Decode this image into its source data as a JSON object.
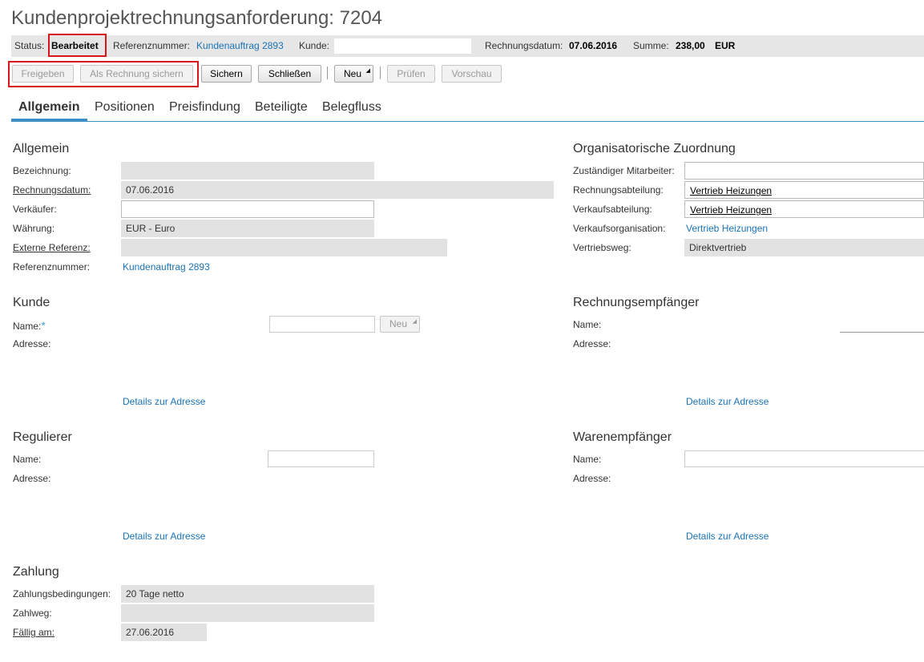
{
  "title": "Kundenprojektrechnungsanforderung: 7204",
  "status_bar": {
    "status_label": "Status:",
    "status_value": "Bearbeitet",
    "ref_label": "Referenznummer:",
    "ref_value": "Kundenauftrag 2893",
    "customer_label": "Kunde:",
    "customer_value": "",
    "date_label": "Rechnungsdatum:",
    "date_value": "07.06.2016",
    "sum_label": "Summe:",
    "sum_value": "238,00",
    "currency": "EUR"
  },
  "toolbar": {
    "release": "Freigeben",
    "save_as_invoice": "Als Rechnung sichern",
    "save": "Sichern",
    "close": "Schließen",
    "new": "Neu",
    "check": "Prüfen",
    "preview": "Vorschau"
  },
  "tabs": [
    "Allgemein",
    "Positionen",
    "Preisfindung",
    "Beteiligte",
    "Belegfluss"
  ],
  "general": {
    "heading": "Allgemein",
    "description_label": "Bezeichnung:",
    "description_value": "",
    "invoice_date_label": "Rechnungsdatum:",
    "invoice_date_value": "07.06.2016",
    "seller_label": "Verkäufer:",
    "seller_value": "",
    "currency_label": "Währung:",
    "currency_value": "EUR - Euro",
    "ext_ref_label": "Externe Referenz:",
    "ext_ref_value": "",
    "ref_label": "Referenznummer:",
    "ref_value": "Kundenauftrag 2893"
  },
  "org": {
    "heading": "Organisatorische Zuordnung",
    "employee_label": "Zuständiger Mitarbeiter:",
    "employee_value": "",
    "invoice_dept_label": "Rechnungsabteilung:",
    "invoice_dept_value": "Vertrieb Heizungen",
    "sales_dept_label": "Verkaufsabteilung:",
    "sales_dept_value": "Vertrieb Heizungen",
    "sales_org_label": "Verkaufsorganisation:",
    "sales_org_value": "Vertrieb Heizungen",
    "channel_label": "Vertriebsweg:",
    "channel_value": "Direktvertrieb"
  },
  "customer": {
    "heading": "Kunde",
    "name_label": "Name:",
    "name_value": "",
    "new_button": "Neu",
    "address_label": "Adresse:",
    "address_link": "Details zur Adresse"
  },
  "bill_to": {
    "heading": "Rechnungsempfänger",
    "name_label": "Name:",
    "address_label": "Adresse:",
    "address_link": "Details zur Adresse"
  },
  "payer": {
    "heading": "Regulierer",
    "name_label": "Name:",
    "address_label": "Adresse:",
    "address_link": "Details zur Adresse"
  },
  "ship_to": {
    "heading": "Warenempfänger",
    "name_label": "Name:",
    "address_label": "Adresse:",
    "address_link": "Details zur Adresse"
  },
  "payment": {
    "heading": "Zahlung",
    "terms_label": "Zahlungsbedingungen:",
    "terms_value": "20 Tage netto",
    "method_label": "Zahlweg:",
    "method_value": "",
    "due_label": "Fällig am:",
    "due_value": "27.06.2016"
  },
  "colors": {
    "accent": "#3d8fc6",
    "link": "#1a73b5",
    "highlight": "#d9141b",
    "readonly": "#e2e2e2"
  }
}
